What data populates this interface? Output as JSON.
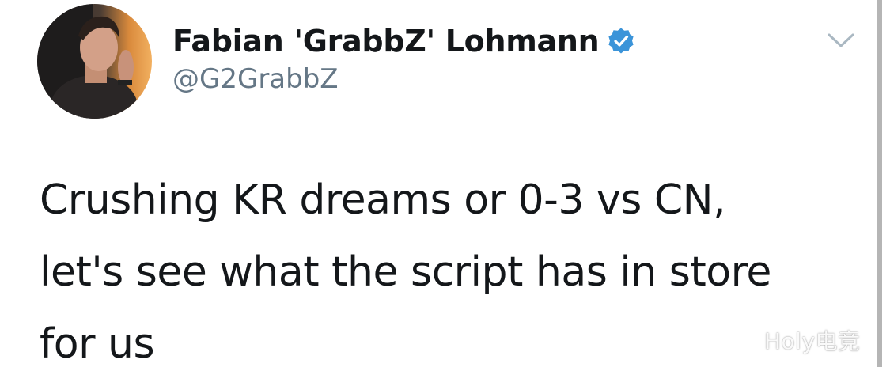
{
  "author": {
    "display_name": "Fabian 'GrabbZ' Lohmann",
    "handle": "@G2GrabbZ",
    "verified": true,
    "verified_color": "#3b94d9"
  },
  "tweet": {
    "lines": [
      "Crushing KR dreams or 0-3 vs CN,",
      "let's see what the script has in store",
      "for us"
    ]
  },
  "watermark": {
    "text": "Holy电竞"
  },
  "icons": {
    "avatar": "profile-photo",
    "verified": "verified-badge-icon",
    "menu": "chevron-down-icon"
  },
  "colors": {
    "text": "#14171a",
    "secondary": "#657786",
    "background": "#ffffff"
  }
}
